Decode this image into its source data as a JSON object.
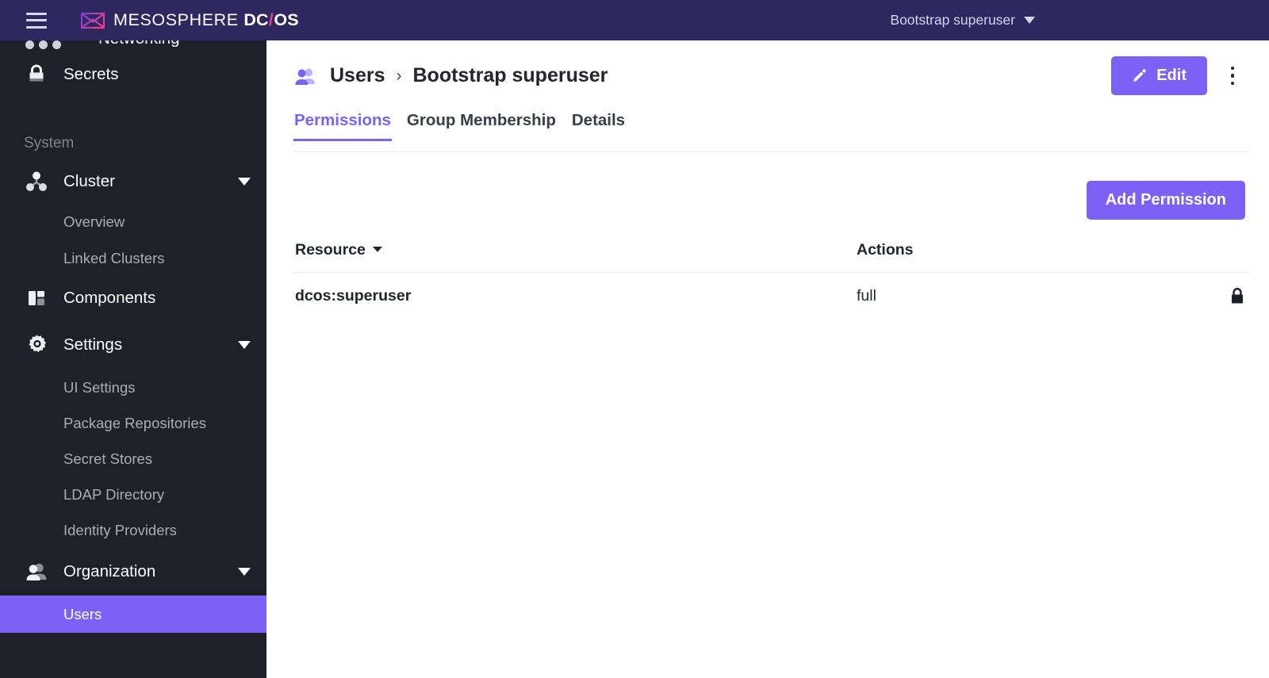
{
  "topbar": {
    "menu_icon": "hamburger-icon",
    "brand_mark_icon": "mesosphere-logo-icon",
    "brand_name": "MESOSPHERE",
    "brand_product_dc": "DC",
    "brand_product_slash": "/",
    "brand_product_os": "OS",
    "user_label": "Bootstrap superuser",
    "user_caret_icon": "chevron-down-icon",
    "background_color": "#2e2760",
    "accent_pink": "#e83f94"
  },
  "sidebar": {
    "background_color": "#1e2129",
    "active_color": "#7b61f5",
    "clipped_top_item": {
      "icon": "ellipsis-icon",
      "label": "Networking"
    },
    "items": [
      {
        "type": "item",
        "icon": "lock-icon",
        "label": "Secrets",
        "expandable": false,
        "active": false
      },
      {
        "type": "section",
        "label": "System"
      },
      {
        "type": "item",
        "icon": "cluster-nodes-icon",
        "label": "Cluster",
        "expandable": true,
        "active": false
      },
      {
        "type": "sub",
        "label": "Overview",
        "active": false
      },
      {
        "type": "sub",
        "label": "Linked Clusters",
        "active": false
      },
      {
        "type": "item",
        "icon": "components-grid-icon",
        "label": "Components",
        "expandable": false,
        "active": false
      },
      {
        "type": "item",
        "icon": "gear-icon",
        "label": "Settings",
        "expandable": true,
        "active": false
      },
      {
        "type": "sub",
        "label": "UI Settings",
        "active": false
      },
      {
        "type": "sub",
        "label": "Package Repositories",
        "active": false
      },
      {
        "type": "sub",
        "label": "Secret Stores",
        "active": false
      },
      {
        "type": "sub",
        "label": "LDAP Directory",
        "active": false
      },
      {
        "type": "sub",
        "label": "Identity Providers",
        "active": false
      },
      {
        "type": "item",
        "icon": "users-icon",
        "label": "Organization",
        "expandable": true,
        "active": false
      },
      {
        "type": "sub",
        "label": "Users",
        "active": true
      }
    ]
  },
  "page": {
    "breadcrumb": {
      "icon": "user-avatar-icon",
      "root_label": "Users",
      "separator": "›",
      "current_label": "Bootstrap superuser"
    },
    "edit_button": {
      "label": "Edit",
      "icon": "pencil-icon",
      "color": "#7b61f5"
    },
    "overflow_menu_icon": "kebab-menu-icon",
    "tabs": [
      {
        "label": "Permissions",
        "active": true
      },
      {
        "label": "Group Membership",
        "active": false
      },
      {
        "label": "Details",
        "active": false
      }
    ],
    "add_permission_button": {
      "label": "Add Permission",
      "color": "#7b61f5"
    },
    "table": {
      "columns": [
        {
          "key": "resource",
          "label": "Resource",
          "sorted": true,
          "sort_icon": "caret-down-icon"
        },
        {
          "key": "actions",
          "label": "Actions",
          "sorted": false
        },
        {
          "key": "lock",
          "label": "",
          "sorted": false
        }
      ],
      "rows": [
        {
          "resource": "dcos:superuser",
          "actions": "full",
          "locked": true,
          "lock_icon": "lock-icon"
        }
      ]
    }
  }
}
